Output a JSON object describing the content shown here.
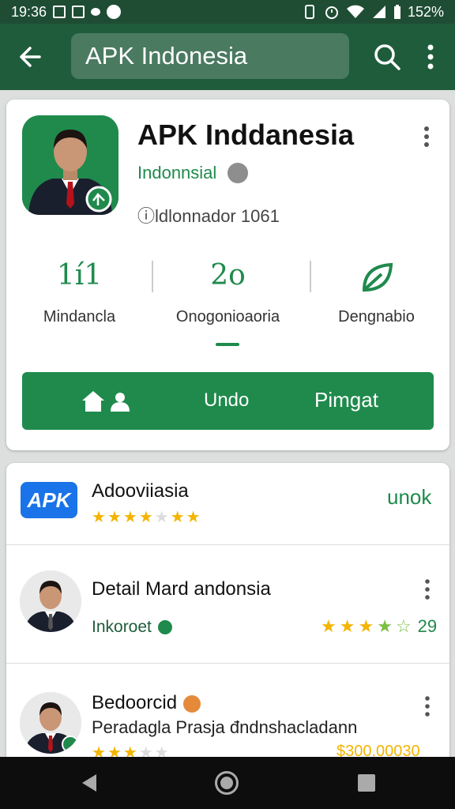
{
  "status_bar": {
    "time": "19:36",
    "battery": "152%"
  },
  "search": {
    "query": "APK Indonesia"
  },
  "app": {
    "title": "APK Inddanesia",
    "developer": "Indonnsial",
    "meta": "ⓘldlonnador 1061",
    "stats": [
      {
        "value": "1í1",
        "label": "Mindancla"
      },
      {
        "value": "2o",
        "label": "Onogonioaoria"
      },
      {
        "value": "",
        "label": "Dengnabio"
      }
    ],
    "install": {
      "undo_label": "Undo",
      "primary_label": "Pimgat"
    }
  },
  "list": {
    "row1": {
      "logo": "APK",
      "title": "Adooviiasia",
      "rating": 4,
      "action": "unok"
    },
    "row2": {
      "title": "Detail Mard andonsia",
      "developer": "Inkoroet",
      "rating": 4.5,
      "count": "29"
    },
    "row3": {
      "title": "Bedoorcid",
      "subtitle": "Peradagla Prasja đndnshacladann",
      "price": "$300.00030",
      "rating": 3.5
    }
  },
  "colors": {
    "primary": "#1f8a4c",
    "appbar": "#1f5c3b",
    "star": "#f4b400"
  },
  "icons": [
    "back-arrow-icon",
    "search-icon",
    "more-vert-icon",
    "globe-icon",
    "leaf-icon",
    "install-icon",
    "shield-icon",
    "star-icon",
    "nav-back-icon",
    "nav-home-icon",
    "nav-recent-icon"
  ]
}
